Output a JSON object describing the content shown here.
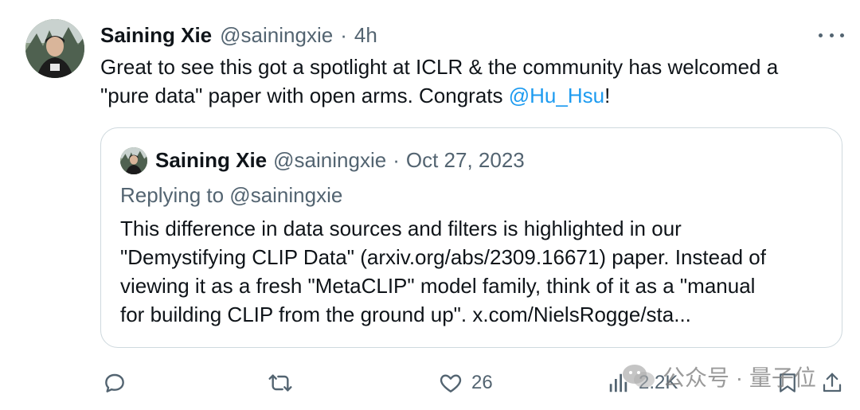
{
  "tweet": {
    "author": {
      "name": "Saining Xie",
      "handle": "@sainingxie",
      "separator": "·",
      "time": "4h"
    },
    "text": {
      "line1": "Great to see this got a spotlight at ICLR & the community has welcomed a",
      "line2_before": "\"pure data\" paper with open arms. Congrats ",
      "mention": "@Hu_Hsu",
      "line2_after": "!"
    },
    "more_icon": "more-horizontal-icon"
  },
  "quote": {
    "author": {
      "name": "Saining Xie",
      "handle": "@sainingxie",
      "separator": "·",
      "date": "Oct 27, 2023"
    },
    "replying_to": "Replying to @sainingxie",
    "body": {
      "line1": "This difference in data sources and filters is highlighted in our",
      "line2": "\"Demystifying CLIP Data\" (arxiv.org/abs/2309.16671) paper. Instead of",
      "line3": "viewing it as a fresh \"MetaCLIP\" model family, think of it as a \"manual",
      "line4": "for building CLIP from the ground up\". x.com/NielsRogge/sta..."
    }
  },
  "actions": {
    "reply": {
      "icon": "reply-icon"
    },
    "retweet": {
      "icon": "retweet-icon"
    },
    "like": {
      "icon": "heart-icon",
      "count": "26"
    },
    "views": {
      "icon": "views-chart-icon",
      "count": "2.2K"
    },
    "bookmark": {
      "icon": "bookmark-icon"
    },
    "share": {
      "icon": "share-icon"
    }
  },
  "watermark": {
    "text": "公众号 · 量子位"
  },
  "colors": {
    "text": "#0f1419",
    "secondary": "#536471",
    "link": "#1d9bf0",
    "border": "#cfd9de"
  }
}
